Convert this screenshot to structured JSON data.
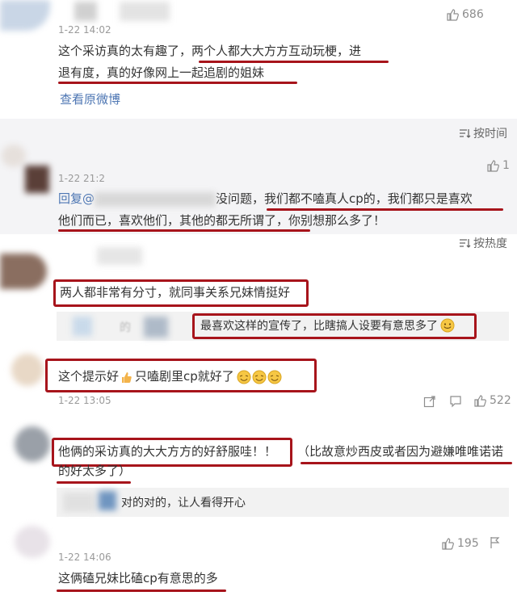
{
  "comments": [
    {
      "time": "1-22 14:02",
      "likes": "686",
      "text_line1": "这个采访真的太有趣了，两个人都大大方方互动玩梗，进",
      "text_line2": "退有度，真的好像网上一起追剧的姐妹",
      "link": "查看原微博"
    },
    {
      "time": "1-22 21:2",
      "likes": "1",
      "reply_prefix": "回复@",
      "reply_mid": "没问题，",
      "text_line1_red": "我们都不嗑真人cp的，我们都只是喜欢",
      "text_line2": "他们而已，喜欢他们，其他的都无所谓了，你别想那么多了！"
    },
    {
      "text": "两人都非常有分寸，就同事关系兄妹情挺好",
      "reply_user": "的",
      "reply_text": "最喜欢这样的宣传了，比瞎搞人设要有意思多了"
    },
    {
      "text": "这个提示好",
      "text2": "只嗑剧里cp就好了",
      "time": "1-22 13:05",
      "likes": "522"
    },
    {
      "text_line1": "他俩的采访真的大大方方的好舒服哇！！",
      "text_line1b": "（比故意炒西皮或者因为避嫌唯唯诺诺",
      "text_line2": "的好太多了）",
      "reply_text": "对的对的，让人看得开心"
    },
    {
      "time": "1-22 14:06",
      "likes": "195",
      "text": "这俩磕兄妹比磕cp有意思的多"
    }
  ],
  "sort": {
    "by_time": "按时间",
    "by_heat": "按热度"
  },
  "colors": {
    "annotation_red": "#a7141b",
    "link_blue": "#4d76b3"
  }
}
